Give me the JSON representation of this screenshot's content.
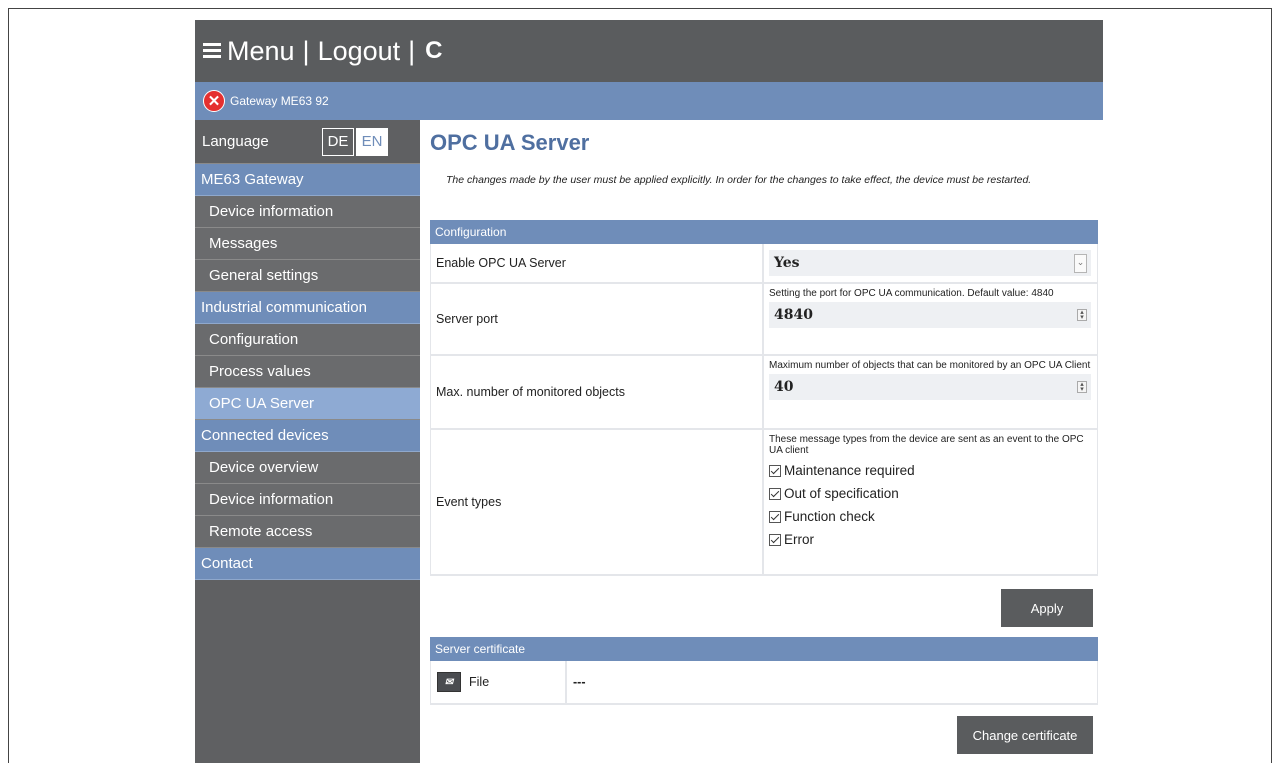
{
  "topbar": {
    "menu_label": "Menu",
    "separator": "|",
    "logout_label": "Logout",
    "refresh_glyph": "C"
  },
  "status": {
    "icon": "error-icon",
    "icon_glyph": "✕",
    "gateway_name": "Gateway ME63 92"
  },
  "sidebar": {
    "language_label": "Language",
    "lang_de": "DE",
    "lang_en": "EN",
    "sections": [
      {
        "label": "ME63 Gateway",
        "items": [
          "Device information",
          "Messages",
          "General settings"
        ]
      },
      {
        "label": "Industrial communication",
        "items": [
          "Configuration",
          "Process values",
          "OPC UA Server"
        ]
      },
      {
        "label": "Connected devices",
        "items": [
          "Device overview",
          "Device information",
          "Remote access"
        ]
      },
      {
        "label": "Contact",
        "items": []
      }
    ],
    "active_item": "OPC UA Server"
  },
  "main": {
    "title": "OPC UA Server",
    "note": "The changes made by the user must be applied explicitly. In order for the changes to take effect, the device must be restarted.",
    "config_header": "Configuration",
    "enable_label": "Enable OPC UA Server",
    "enable_value": "Yes",
    "port_label": "Server port",
    "port_help": "Setting the port for OPC UA communication. Default value: 4840",
    "port_value": "4840",
    "max_label": "Max. number of monitored objects",
    "max_help": "Maximum number of objects that can be monitored by an OPC UA Client",
    "max_value": "40",
    "event_label": "Event types",
    "event_help": "These message types from the device are sent as an event to the OPC UA client",
    "events": [
      "Maintenance required",
      "Out of specification",
      "Function check",
      "Error"
    ],
    "apply_label": "Apply",
    "cert_header": "Server certificate",
    "cert_file_label": "File",
    "cert_file_value": "---",
    "change_cert_label": "Change certificate"
  },
  "colors": {
    "topbar": "#5a5c5e",
    "accent_blue": "#6f8db9",
    "active_nav": "#8eaad3",
    "title_blue": "#4f6fa0",
    "error_red": "#e53030"
  }
}
